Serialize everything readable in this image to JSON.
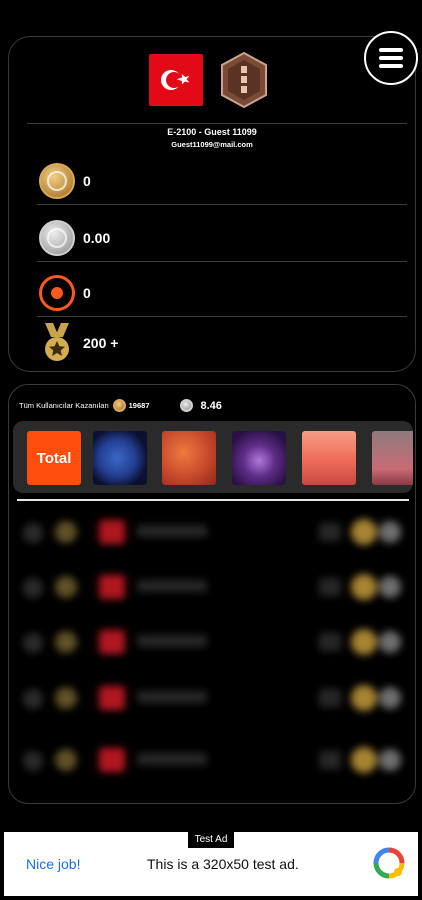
{
  "profile": {
    "user_line": "E-2100  -  Guest 11099",
    "email": "Guest11099@mail.com",
    "country_flag_icon": "turkey-flag-icon",
    "rank_badge_icon": "rank-badge-icon"
  },
  "stats": {
    "gold": "0",
    "silver": "0.00",
    "target": "0",
    "medal": "200 +"
  },
  "board": {
    "label": "Tüm Kullanıcılar Kazanılan",
    "gold_total": "19687",
    "silver_total": "8.46",
    "tabs": [
      {
        "label": "Total",
        "icon": "total-tab"
      },
      {
        "icon": "blue-planet-thumbnail"
      },
      {
        "icon": "red-planet-thumbnail"
      },
      {
        "icon": "purple-planet-thumbnail"
      },
      {
        "icon": "sunset-thumbnail"
      },
      {
        "icon": "character-thumbnail"
      }
    ],
    "rows": 5
  },
  "ad": {
    "tag": "Test Ad",
    "cta": "Nice job!",
    "text": "This is a 320x50 test ad."
  },
  "colors": {
    "accent_orange": "#ff4d0d",
    "flag_red": "#e30a17",
    "link_blue": "#1a73e8"
  }
}
